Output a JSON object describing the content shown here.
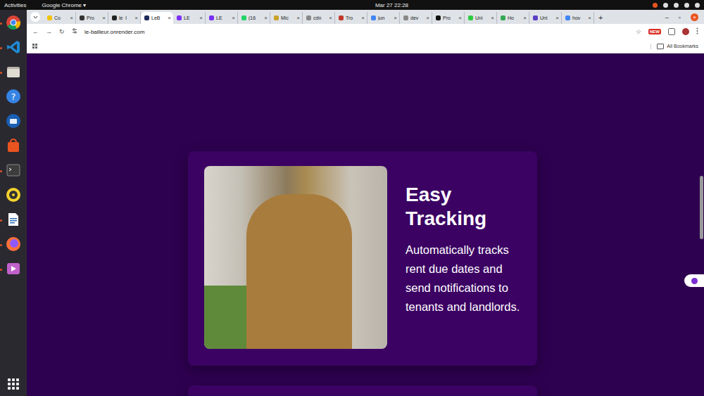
{
  "topbar": {
    "activities": "Activities",
    "app": "Google Chrome ▾",
    "clock": "Mar 27  22:28"
  },
  "dock": {
    "items": [
      {
        "kind": "chrome",
        "running": true
      },
      {
        "kind": "vscode",
        "running": true
      },
      {
        "kind": "files",
        "running": true
      },
      {
        "kind": "help",
        "running": false
      },
      {
        "kind": "thunderbird",
        "running": false
      },
      {
        "kind": "appcenter",
        "running": false
      },
      {
        "kind": "terminal",
        "running": true
      },
      {
        "kind": "rhythmbox",
        "running": false
      },
      {
        "kind": "writer",
        "running": true
      },
      {
        "kind": "firefox",
        "running": true
      },
      {
        "kind": "video",
        "running": true
      }
    ]
  },
  "tabs": [
    {
      "label": "Co",
      "selected": false,
      "color": "#f4c20d"
    },
    {
      "label": "Pro",
      "selected": false,
      "color": "#333333"
    },
    {
      "label": "le_l",
      "selected": false,
      "color": "#222222"
    },
    {
      "label": "LeB",
      "selected": true,
      "color": "#1f2a5a"
    },
    {
      "label": "LE",
      "selected": false,
      "color": "#7b2ff7"
    },
    {
      "label": "LE",
      "selected": false,
      "color": "#7b2ff7"
    },
    {
      "label": "(16",
      "selected": false,
      "color": "#25d366"
    },
    {
      "label": "Mic",
      "selected": false,
      "color": "#c9a227"
    },
    {
      "label": "cdn",
      "selected": false,
      "color": "#888888"
    },
    {
      "label": "Tro",
      "selected": false,
      "color": "#c0392b"
    },
    {
      "label": "jun",
      "selected": false,
      "color": "#4285f4"
    },
    {
      "label": "dev",
      "selected": false,
      "color": "#888888"
    },
    {
      "label": "Pro",
      "selected": false,
      "color": "#111111"
    },
    {
      "label": "Uni",
      "selected": false,
      "color": "#2ecc40"
    },
    {
      "label": "Ho",
      "selected": false,
      "color": "#34a853"
    },
    {
      "label": "Uni",
      "selected": false,
      "color": "#5b3fc4"
    },
    {
      "label": "hov",
      "selected": false,
      "color": "#4285f4"
    }
  ],
  "tab_close": "×",
  "new_tab": "+",
  "window_controls": [
    "–",
    "▫",
    "×"
  ],
  "toolbar": {
    "back": "←",
    "forward": "→",
    "reload": "↻",
    "url": "le-bailleur.onrender.com",
    "star": "☆",
    "badge": "NEW"
  },
  "bookmarks": {
    "all": "All Bookmarks"
  },
  "feature": {
    "title": "Easy Tracking",
    "description": "Automatically tracks rent due dates and send notifications to tenants and landlords."
  }
}
